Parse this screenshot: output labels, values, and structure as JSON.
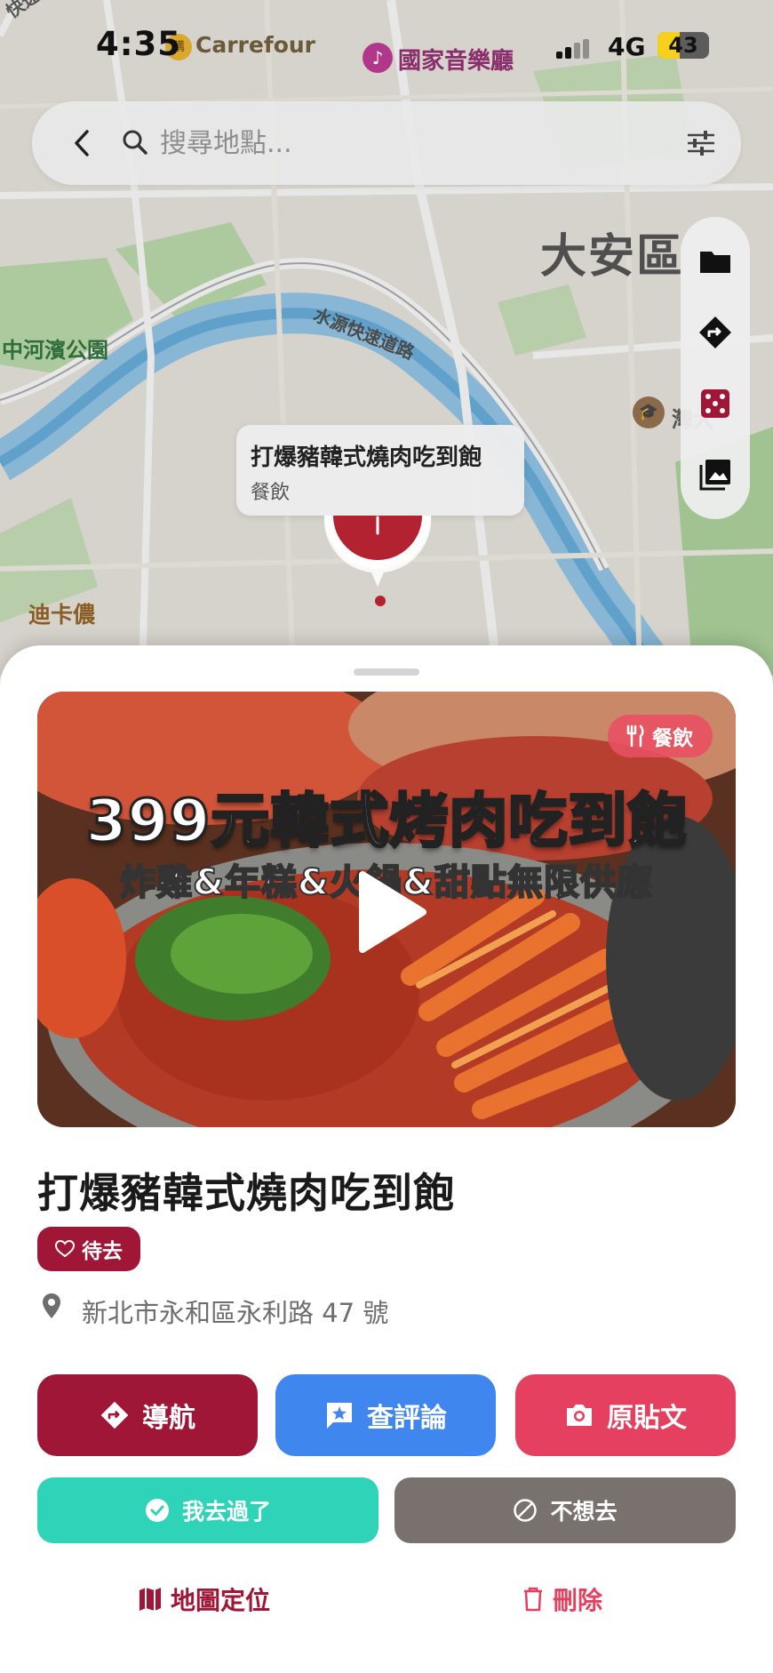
{
  "status_bar": {
    "time": "4:35",
    "network": "4G",
    "battery": "43",
    "battery_level": 0.43
  },
  "map": {
    "labels": {
      "carrefour": "Carrefour",
      "concert_hall": "國家音樂廳",
      "district": "大安區",
      "park": "中河濱公園",
      "road": "水源快速道路",
      "dika": "迪卡儂",
      "top_left_road": "快速道",
      "gw": "灣大"
    }
  },
  "search": {
    "placeholder": "搜尋地點..."
  },
  "toolbar": {
    "icons": [
      "folder-icon",
      "directions-icon",
      "dice-icon",
      "photo-library-icon"
    ]
  },
  "callout": {
    "title": "打爆豬韓式燒肉吃到飽",
    "category": "餐飲"
  },
  "detail": {
    "media_overlay_line1": "399元韓式烤肉吃到飽",
    "media_overlay_line2": "炸雞&年糕&火鍋&甜點無限供應",
    "category_badge": "餐飲",
    "title": "打爆豬韓式燒肉吃到飽",
    "status_chip": "待去",
    "address": "新北市永和區永利路 47 號"
  },
  "actions": {
    "navigate": "導航",
    "reviews": "查評論",
    "original_post": "原貼文",
    "been_there": "我去過了",
    "not_interested": "不想去",
    "map_locate": "地圖定位",
    "delete": "刪除"
  },
  "colors": {
    "primary": "#a01637",
    "blue": "#3f87ef",
    "pink": "#e5405f",
    "teal": "#2fd3b7",
    "gray": "#78716e"
  }
}
